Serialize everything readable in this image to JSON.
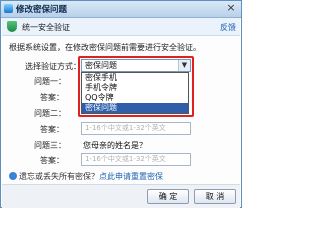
{
  "window": {
    "title": "修改密保问题",
    "close_glyph": "×"
  },
  "banner": {
    "text": "统一安全验证",
    "feedback": "反馈"
  },
  "intro": "根据系统设置，在修改密保问题前需要进行安全验证。",
  "verify": {
    "label": "选择验证方式：",
    "selected": "密保问题",
    "options": [
      "密保手机",
      "手机令牌",
      "QQ令牌",
      "密保问题"
    ],
    "selected_index": 3
  },
  "questions": [
    {
      "q_label": "问题一：",
      "a_label": "答案："
    },
    {
      "q_label": "问题二：",
      "a_label": "答案："
    },
    {
      "q_label": "问题三：",
      "question": "您母亲的姓名是？",
      "a_label": "答案："
    }
  ],
  "answer_placeholder": "1-16个中文或1-32个英文",
  "hint": {
    "text": "遗忘或丢失所有密保？",
    "link": "点此申请重置密保"
  },
  "buttons": {
    "ok": "确 定",
    "cancel": "取 消"
  }
}
